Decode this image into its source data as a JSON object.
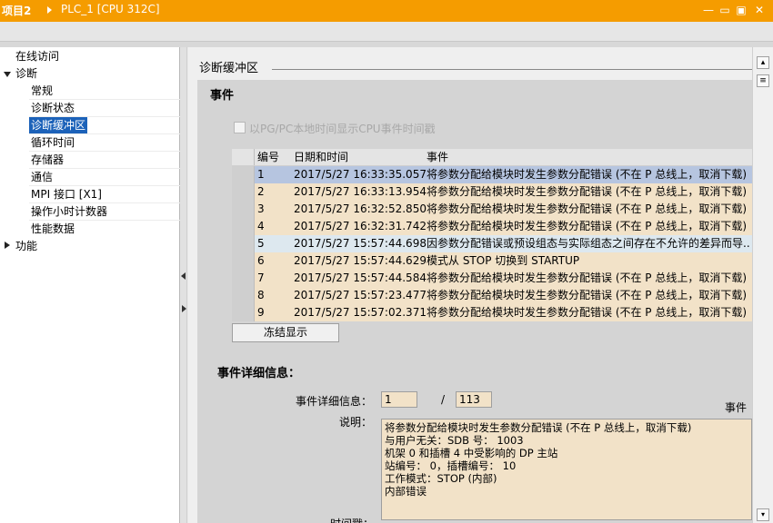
{
  "titlebar": {
    "project": "项目2",
    "device": "PLC_1 [CPU 312C]",
    "minimize": "—",
    "restore": "▭",
    "maximize": "▣",
    "close": "✕"
  },
  "nav": {
    "online_access": "在线访问",
    "diagnostics": "诊断",
    "items": [
      "常规",
      "诊断状态",
      "诊断缓冲区",
      "循环时间",
      "存储器",
      "通信",
      "MPI 接口 [X1]",
      "操作小时计数器",
      "性能数据"
    ],
    "functions": "功能"
  },
  "section_title": "诊断缓冲区",
  "events_heading": "事件",
  "checkbox_label": "以PG/PC本地时间显示CPU事件时间戳",
  "table": {
    "headers": [
      "编号",
      "日期和时间",
      "事件"
    ],
    "rows": [
      {
        "no": "1",
        "time": "2017/5/27 16:33:35.057",
        "event": "将参数分配给模块时发生参数分配错误 (不在 P 总线上，取消下载)"
      },
      {
        "no": "2",
        "time": "2017/5/27 16:33:13.954",
        "event": "将参数分配给模块时发生参数分配错误 (不在 P 总线上，取消下载)"
      },
      {
        "no": "3",
        "time": "2017/5/27 16:32:52.850",
        "event": "将参数分配给模块时发生参数分配错误 (不在 P 总线上，取消下载)"
      },
      {
        "no": "4",
        "time": "2017/5/27 16:32:31.742",
        "event": "将参数分配给模块时发生参数分配错误 (不在 P 总线上，取消下载)"
      },
      {
        "no": "5",
        "time": "2017/5/27 15:57:44.698",
        "event": "因参数分配错误或预设组态与实际组态之间存在不允许的差异而导..."
      },
      {
        "no": "6",
        "time": "2017/5/27 15:57:44.629",
        "event": "模式从 STOP 切换到 STARTUP"
      },
      {
        "no": "7",
        "time": "2017/5/27 15:57:44.584",
        "event": "将参数分配给模块时发生参数分配错误 (不在 P 总线上，取消下载)"
      },
      {
        "no": "8",
        "time": "2017/5/27 15:57:23.477",
        "event": "将参数分配给模块时发生参数分配错误 (不在 P 总线上，取消下载)"
      },
      {
        "no": "9",
        "time": "2017/5/27 15:57:02.371",
        "event": "将参数分配给模块时发生参数分配错误 (不在 P 总线上，取消下载)"
      }
    ]
  },
  "freeze_button": "冻结显示",
  "details_heading": "事件详细信息：",
  "details": {
    "event_label": "事件详细信息：",
    "current": "1",
    "separator": "/",
    "total": "113",
    "event_col": "事件",
    "desc_label": "说明：",
    "desc_lines": [
      "将参数分配给模块时发生参数分配错误 (不在 P 总线上，取消下载)",
      "与用户无关：SDB 号：    1003",
      "机架   0 和插槽    4 中受影响的 DP 主站",
      "站编号：   0，插槽编号：   10",
      "工作模式：STOP (内部)",
      "内部错误"
    ],
    "timestamp_label": "时间戳："
  }
}
